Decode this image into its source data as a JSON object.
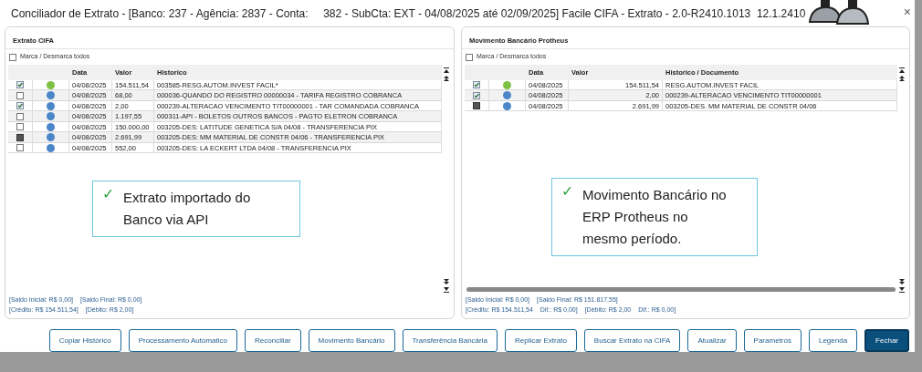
{
  "window": {
    "title": "Conciliador de Extrato - [Banco: 237 - Agência: 2837 - Conta:     382 - SubCta: EXT - 04/08/2025 até 02/09/2025] Facile CIFA - Extrato - 2.0-R2410.1013  12.1.2410",
    "close": "×"
  },
  "panels": [
    {
      "kind": "statement",
      "title": "Extrato CIFA",
      "mark_all": {
        "label": "Marca / Desmarca todos",
        "checked": false
      },
      "columns": [
        "Data",
        "Valor",
        "Historico"
      ],
      "rows": [
        {
          "checked": true,
          "disabled": false,
          "color": "#7cc142",
          "cells": [
            "04/08/2025",
            "154.511,54",
            "003585-RESG.AUTOM.INVEST FACIL*"
          ]
        },
        {
          "checked": false,
          "disabled": false,
          "color": "#4a86c8",
          "cells": [
            "04/08/2025",
            "68,00",
            "000036-QUANDO DO REGISTRO 00000034 - TARIFA REGISTRO COBRANCA"
          ]
        },
        {
          "checked": true,
          "disabled": false,
          "color": "#4a86c8",
          "cells": [
            "04/08/2025",
            "2,00",
            "000239-ALTERACAO VENCIMENTO TIT00000001 - TAR COMANDADA COBRANCA"
          ]
        },
        {
          "checked": false,
          "disabled": false,
          "color": "#4a86c8",
          "cells": [
            "04/08/2025",
            "1.197,55",
            "000311-API - BOLETOS OUTROS BANCOS - PAGTO ELETRON COBRANCA"
          ]
        },
        {
          "checked": false,
          "disabled": false,
          "color": "#4a86c8",
          "cells": [
            "04/08/2025",
            "150.000,00",
            "003205-DES: LATITUDE GENETICA S/A 04/08 - TRANSFERENCIA PIX"
          ]
        },
        {
          "checked": false,
          "disabled": true,
          "color": "#4a86c8",
          "cells": [
            "04/08/2025",
            "2.691,99",
            "003205-DES: MM MATERIAL DE CONSTR 04/06 - TRANSFERENCIA PIX"
          ]
        },
        {
          "checked": false,
          "disabled": false,
          "color": "#4a86c8",
          "cells": [
            "04/08/2025",
            "552,00",
            "003205-DES: LA ECKERT LTDA 04/08 - TRANSFERENCIA PIX"
          ]
        }
      ],
      "summary": [
        [
          "[Saldo Inicial: R$ 0,00]",
          "[Saldo Final: R$ 0,00]"
        ],
        [
          "[Crédito: R$ 154.511,54]",
          "[Débito: R$ 2,00]"
        ]
      ],
      "callout": {
        "icon": "✓",
        "text": "Extrato importado do Banco via API"
      }
    },
    {
      "kind": "erp",
      "title": "Movimento Bancário Protheus",
      "mark_all": {
        "label": "Marca / Desmarca todos",
        "checked": false
      },
      "columns": [
        "Data",
        "Valor",
        "Historico / Documento"
      ],
      "rows": [
        {
          "checked": true,
          "disabled": false,
          "color": "#7cc142",
          "cells": [
            "04/08/2025",
            "154.511,54",
            "RESG.AUTOM.INVEST FACIL"
          ]
        },
        {
          "checked": true,
          "disabled": false,
          "color": "#4a86c8",
          "cells": [
            "04/08/2025",
            "2,00",
            "000239-ALTERACAO VENCIMENTO TIT00000001"
          ]
        },
        {
          "checked": false,
          "disabled": true,
          "color": "#4a86c8",
          "cells": [
            "04/08/2025",
            "2.691,99",
            "003205-DES. MM MATERIAL DE CONSTR 04/06"
          ]
        }
      ],
      "summary": [
        [
          "[Saldo Inicial: R$ 0,00]",
          "[Saldo Final: R$ 151.817,55]"
        ],
        [
          "[Crédito: R$ 154.511,54",
          "Dif.: R$ 0,00]",
          "[Débito: R$ 2,00",
          "Dif.: R$ 0,00]"
        ]
      ],
      "callout": {
        "icon": "✓",
        "text": "Movimento Bancário no ERP Protheus no mesmo período."
      }
    }
  ],
  "buttons": [
    {
      "label": "Copiar Histórico",
      "primary": false
    },
    {
      "label": "Processamento Automatico",
      "primary": false
    },
    {
      "label": "Reconciliar",
      "primary": false
    },
    {
      "label": "Movimento Bancário",
      "primary": false
    },
    {
      "label": "Transferência Bancária",
      "primary": false
    },
    {
      "label": "Replicar Extrato",
      "primary": false
    },
    {
      "label": "Buscar Extrato na CIFA",
      "primary": false
    },
    {
      "label": "Atualizar",
      "primary": false
    },
    {
      "label": "Parametros",
      "primary": false
    },
    {
      "label": "Legenda",
      "primary": false
    },
    {
      "label": "Fechar",
      "primary": true
    }
  ]
}
